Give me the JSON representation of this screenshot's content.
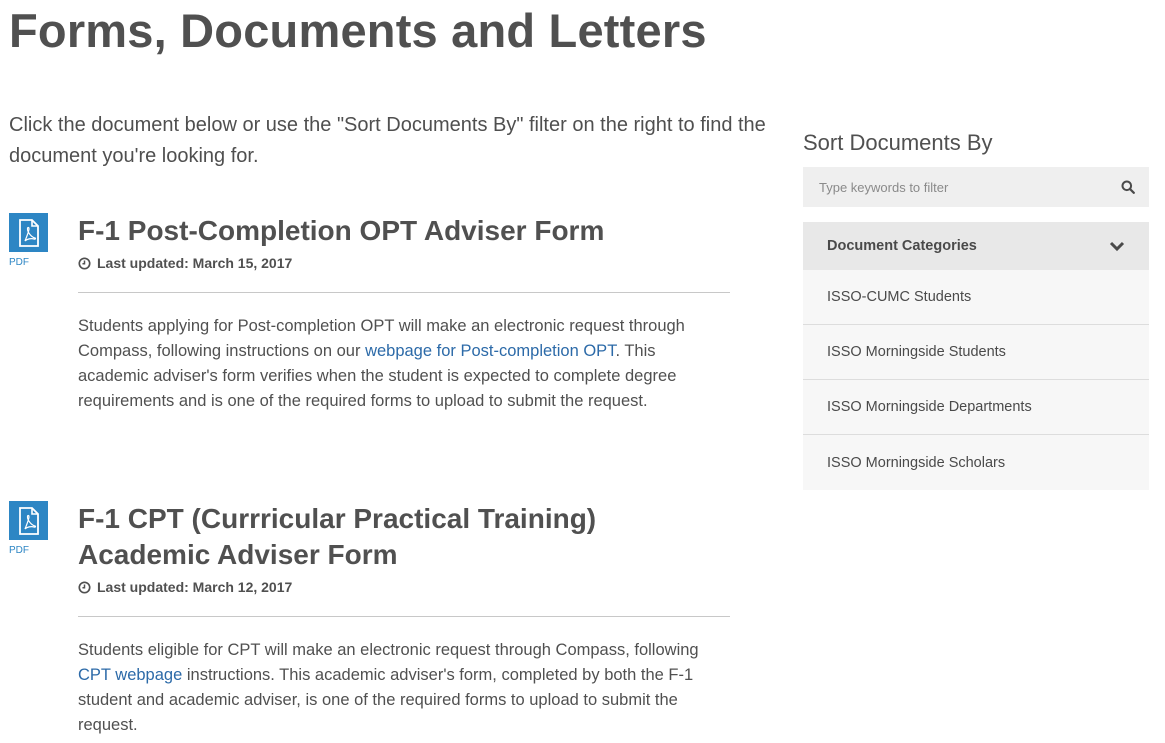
{
  "page": {
    "title": "Forms, Documents and Letters",
    "intro": "Click the document below or use the \"Sort Documents By\" filter on the right to find the document you're looking for."
  },
  "documents": [
    {
      "file_type": "PDF",
      "title": "F-1 Post-Completion OPT Adviser Form",
      "updated": "Last updated: March 15, 2017",
      "desc_before": "Students applying for Post-completion OPT will make an electronic request through Compass, following instructions on our ",
      "link_text": "webpage for Post-completion OPT",
      "desc_after": ". This academic adviser's form verifies when the student is expected to complete degree requirements and is one of the required forms to upload to submit the request."
    },
    {
      "file_type": "PDF",
      "title": "F-1 CPT (Currricular Practical Training) Academic Adviser Form",
      "updated": "Last updated: March 12, 2017",
      "desc_before": "Students eligible for CPT will make an electronic request through Compass, following ",
      "link_text": "CPT webpage",
      "desc_after": " instructions. This academic adviser's form, completed by both the F-1 student and academic adviser, is one of the required forms to upload to submit the request."
    }
  ],
  "sidebar": {
    "title": "Sort Documents By",
    "search_placeholder": "Type keywords to filter",
    "categories_label": "Document Categories",
    "categories": [
      "ISSO-CUMC Students",
      "ISSO Morningside Students",
      "ISSO Morningside Departments",
      "ISSO Morningside Scholars"
    ]
  },
  "colors": {
    "accent": "#2d86c4",
    "link": "#2c6aa8",
    "text": "#505050"
  }
}
